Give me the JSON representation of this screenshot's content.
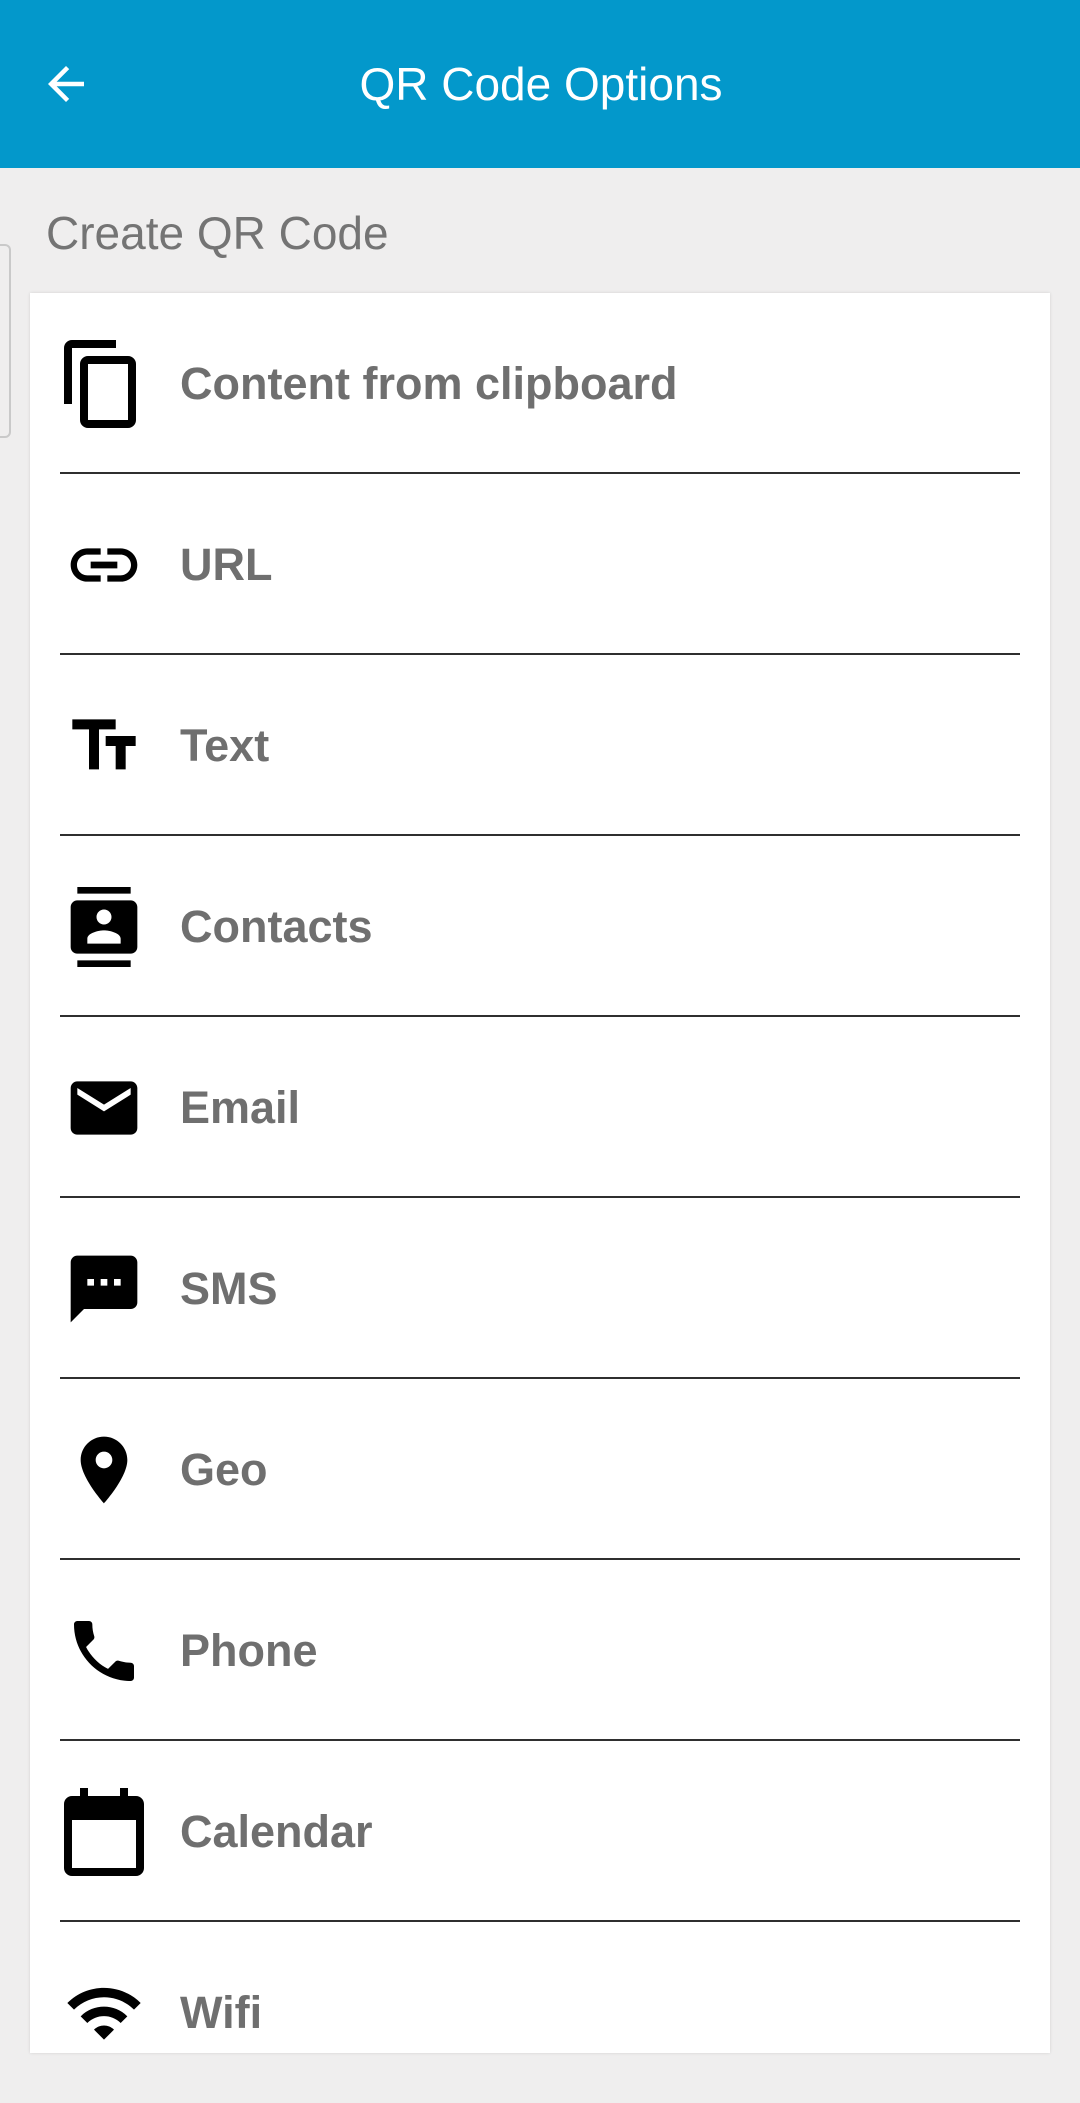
{
  "appbar": {
    "title": "QR Code Options",
    "back_icon": "arrow-back-icon",
    "background": "#0398cb"
  },
  "section": {
    "header": "Create QR Code"
  },
  "options": [
    {
      "label": "Content from clipboard",
      "icon": "clipboard-copy-icon"
    },
    {
      "label": "URL",
      "icon": "link-icon"
    },
    {
      "label": "Text",
      "icon": "text-fields-icon"
    },
    {
      "label": "Contacts",
      "icon": "contacts-icon"
    },
    {
      "label": "Email",
      "icon": "email-icon"
    },
    {
      "label": "SMS",
      "icon": "sms-icon"
    },
    {
      "label": "Geo",
      "icon": "location-pin-icon"
    },
    {
      "label": "Phone",
      "icon": "phone-icon"
    },
    {
      "label": "Calendar",
      "icon": "calendar-icon"
    },
    {
      "label": "Wifi",
      "icon": "wifi-icon"
    }
  ]
}
